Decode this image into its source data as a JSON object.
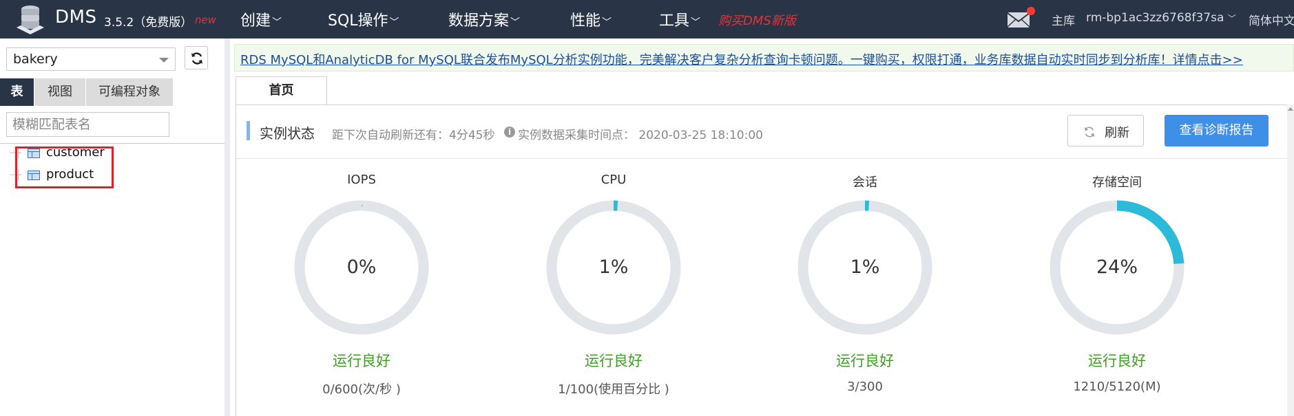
{
  "app": {
    "name": "DMS",
    "version": "3.5.2（免费版）",
    "new_badge": "new"
  },
  "menu": [
    {
      "label": "创建"
    },
    {
      "label": "SQL操作"
    },
    {
      "label": "数据方案"
    },
    {
      "label": "性能"
    },
    {
      "label": "工具"
    }
  ],
  "buy_link": "购买DMS新版",
  "header_right": {
    "db_type": "主库",
    "instance": "rm-bp1ac3zz6768f37sa",
    "language": "简体中文"
  },
  "sidebar": {
    "database": "bakery",
    "tabs": [
      {
        "label": "表",
        "active": true
      },
      {
        "label": "视图",
        "active": false
      },
      {
        "label": "可编程对象",
        "active": false
      }
    ],
    "filter_placeholder": "模糊匹配表名",
    "tables": [
      {
        "name": "customer"
      },
      {
        "name": "product"
      }
    ]
  },
  "banner": {
    "text": "RDS MySQL和AnalyticDB for MySQL联合发布MySQL分析实例功能，完美解决客户复杂分析查询卡顿问题。一键购买，权限打通，业务库数据自动实时同步到分析库！详情点击>>"
  },
  "main": {
    "tab": "首页",
    "status": {
      "title": "实例状态",
      "countdown": "距下次自动刷新还有：4分45秒",
      "collect_time": "实例数据采集时间点： 2020-03-25 18:10:00",
      "refresh_label": "刷新",
      "report_label": "查看诊断报告"
    },
    "metrics": [
      {
        "title": "IOPS",
        "percent": 0,
        "percent_label": "0%",
        "state": "运行良好",
        "usage": "0/600(次/秒 )"
      },
      {
        "title": "CPU",
        "percent": 1,
        "percent_label": "1%",
        "state": "运行良好",
        "usage": "1/100(使用百分比 )"
      },
      {
        "title": "会话",
        "percent": 1,
        "percent_label": "1%",
        "state": "运行良好",
        "usage": "3/300"
      },
      {
        "title": "存储空间",
        "percent": 24,
        "percent_label": "24%",
        "state": "运行良好",
        "usage": "1210/5120(M)"
      }
    ]
  },
  "colors": {
    "topbar": "#2a3447",
    "accent": "#3d8fe8",
    "gauge_fill": "#2bbad8",
    "gauge_track": "#e1e4e8",
    "ok_status": "#3e9d24",
    "highlight": "#e0212b"
  }
}
